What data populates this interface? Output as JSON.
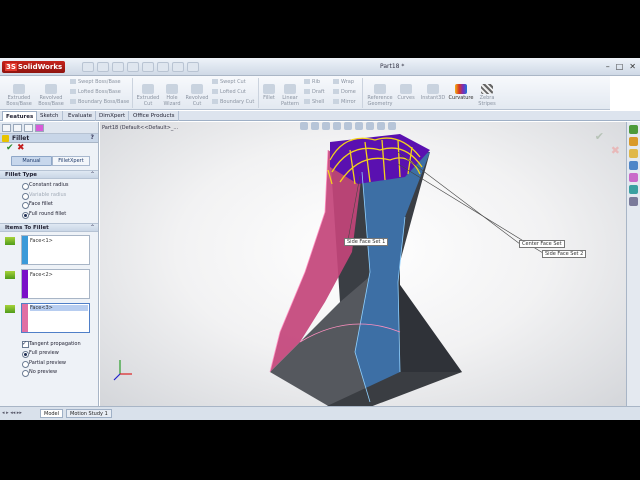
{
  "app": {
    "logo": "SolidWorks",
    "document_title": "Part18 *"
  },
  "ribbon": {
    "features": [
      {
        "label": "Extruded Boss/Base"
      },
      {
        "label": "Revolved Boss/Base"
      },
      {
        "label": "Extruded Cut"
      },
      {
        "label": "Hole Wizard"
      },
      {
        "label": "Revolved Cut"
      },
      {
        "label": "Fillet"
      },
      {
        "label": "Linear Pattern"
      },
      {
        "label": "Reference Geometry"
      },
      {
        "label": "Curves"
      },
      {
        "label": "Instant3D"
      },
      {
        "label": "Curvature"
      },
      {
        "label": "Zebra Stripes"
      }
    ],
    "small_items": [
      "Swept Boss/Base",
      "Lofted Boss/Base",
      "Boundary Boss/Base",
      "Swept Cut",
      "Lofted Cut",
      "Boundary Cut",
      "Rib",
      "Draft",
      "Shell",
      "Wrap",
      "Dome",
      "Mirror"
    ]
  },
  "tabs": [
    "Features",
    "Sketch",
    "Evaluate",
    "DimXpert",
    "Office Products"
  ],
  "property_manager": {
    "title": "Fillet",
    "help": "?",
    "mode_buttons": {
      "manual": "Manual",
      "filletxpert": "FilletXpert"
    },
    "fillet_type": {
      "header": "Fillet Type",
      "options": [
        "Constant radius",
        "Variable radius",
        "Face fillet",
        "Full round fillet"
      ],
      "selected": "Full round fillet"
    },
    "items_to_fillet": {
      "header": "Items To Fillet",
      "side_face_set_1": "Face<1>",
      "center_face_set": "Face<2>",
      "side_face_set_2": "Face<3>",
      "face_colors": [
        "#3a9ad9",
        "#7a10c8",
        "#e06fa4"
      ]
    },
    "tangent_propagation": "Tangent propagation",
    "preview": {
      "options": [
        "Full preview",
        "Partial preview",
        "No preview"
      ],
      "selected": "Full preview"
    }
  },
  "viewport": {
    "breadcrumb": "Part18 (Default<<Default>_...",
    "callouts": {
      "center": "Center Face Set",
      "side1": "Side Face Set 1",
      "side2": "Side Face Set 2"
    }
  },
  "bottom_tabs": [
    "Model",
    "Motion Study 1"
  ]
}
